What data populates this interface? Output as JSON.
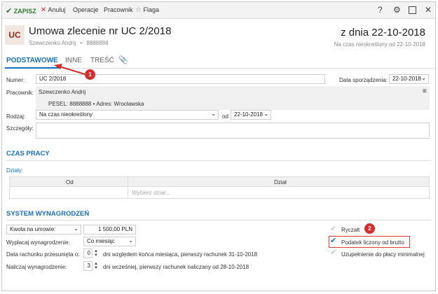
{
  "toolbar": {
    "save": "ZAPISZ",
    "cancel": "Anuluj",
    "operations": "Operacje",
    "employee": "Pracownik",
    "flag": "Flaga",
    "help": "?",
    "settings_icon": "gear-icon",
    "maximize_icon": "square-icon",
    "close": "✕"
  },
  "header": {
    "avatar": "UC",
    "title": "Umowa zlecenie nr UC 2/2018",
    "subtitle_name": "Szewczenko Andrij",
    "subtitle_sep": "•",
    "subtitle_pesel": "8888888",
    "date_title": "z dnia 22-10-2018",
    "date_sub": "Na czas nieokreślony od 22-10-2018"
  },
  "tabs": [
    {
      "label": "PODSTAWOWE",
      "active": true
    },
    {
      "label": "INNE",
      "active": false
    },
    {
      "label": "TREŚĆ",
      "active": false
    }
  ],
  "form": {
    "number_label": "Numer:",
    "number_value": "UC 2/2018",
    "date_label": "Data sporządzenia:",
    "date_value": "22-10-2018",
    "employee_label": "Pracownik:",
    "employee_value": "Szewczenko Andrij",
    "pesel_value": "PESEL: 8888888 • Adres: Wrocławska",
    "type_label": "Rodzaj:",
    "type_value": "Na czas nieokreślony",
    "from_label": "od",
    "from_value": "22-10-2018",
    "details_label": "Szczegóły:"
  },
  "work_time": {
    "section": "CZAS PRACY",
    "departments_link": "Działy:",
    "col_from": "Od",
    "col_department": "Dział",
    "choose_placeholder": "Wybierz dział..."
  },
  "salary": {
    "section": "SYSTEM WYNAGRODZEŃ",
    "amount_type": "Kwota na umowie:",
    "amount_value": "1 500,00 PLN",
    "payout_label": "Wypłacaj wynagrodzenie:",
    "payout_value": "Co miesiąc",
    "shift_label": "Data rachunku przesunięta o:",
    "shift_value": "0",
    "shift_desc": "dni względem końca miesiąca, pierwszy rachunek 31-10-2018",
    "accrue_label": "Naliczaj wynagrodzenie:",
    "accrue_value": "3",
    "accrue_desc": "dni wcześniej, pierwszy rachunek naliczany od 28-10-2018",
    "lump_sum": "Ryczałt",
    "gross_tax": "Podatek liczony od brutto",
    "min_wage": "Uzupełnienie do płacy minimalnej"
  },
  "annotations": {
    "badge1": "1",
    "badge2": "2"
  },
  "colors": {
    "accent": "#1a70b8",
    "save": "#2e7d32",
    "cancel": "#d32f2f",
    "annotation": "#d32f2f"
  }
}
